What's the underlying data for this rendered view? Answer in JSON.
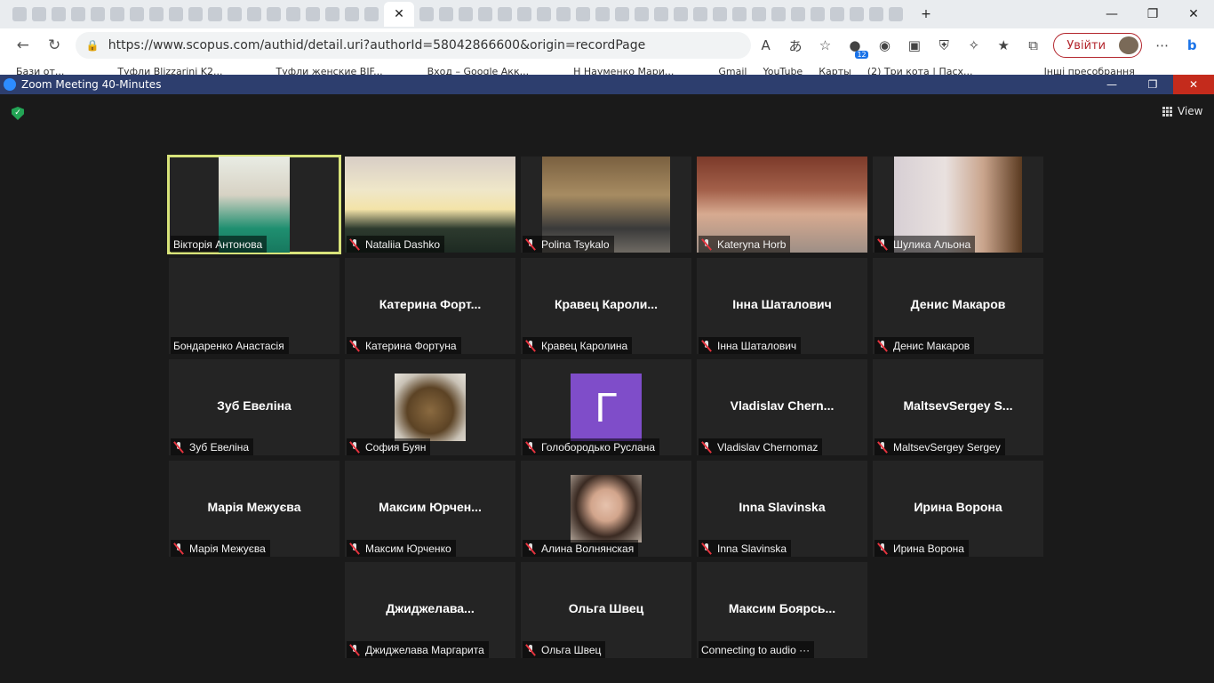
{
  "browser": {
    "url": "https://www.scopus.com/authid/detail.uri?authorId=58042866600&origin=recordPage",
    "login_label": "Увійти",
    "badge_count": "12",
    "bookmarks": [
      "Бази от...",
      "Туфли Blizzarini K2...",
      "Туфли женские BIF...",
      "Вход – Google Акк...",
      "Н Науменко Мари...",
      "Gmail",
      "YouTube",
      "Карты",
      "(2) Три кота | Пасх...",
      "Інші пресобрання"
    ]
  },
  "zoom": {
    "window_title": "Zoom Meeting 40-Minutes",
    "view_label": "View",
    "accent_active": "#d8e37a",
    "participants": [
      {
        "name": "Вікторія Антонова",
        "display": "",
        "video": "photo",
        "muted": false,
        "active": true,
        "row": 0,
        "col": 0
      },
      {
        "name": "Nataliia Dashko",
        "display": "",
        "video": "photo",
        "muted": true,
        "row": 0,
        "col": 1
      },
      {
        "name": "Polina Tsykalo",
        "display": "",
        "video": "photo",
        "muted": true,
        "row": 0,
        "col": 2
      },
      {
        "name": "Kateryna Horb",
        "display": "",
        "video": "photo",
        "muted": true,
        "row": 0,
        "col": 3
      },
      {
        "name": "Шулика Альона",
        "display": "",
        "video": "photo",
        "muted": true,
        "row": 0,
        "col": 4
      },
      {
        "name": "Бондаренко Анастасія",
        "display": "",
        "video": "none",
        "muted": false,
        "row": 1,
        "col": 0
      },
      {
        "name": "Катерина Фортуна",
        "display": "Катерина  Форт...",
        "video": "none",
        "muted": true,
        "row": 1,
        "col": 1
      },
      {
        "name": "Кравец Каролина",
        "display": "Кравец  Кароли...",
        "video": "none",
        "muted": true,
        "row": 1,
        "col": 2
      },
      {
        "name": "Інна Шаталович",
        "display": "Інна Шаталович",
        "video": "none",
        "muted": true,
        "row": 1,
        "col": 3
      },
      {
        "name": "Денис Макаров",
        "display": "Денис Макаров",
        "video": "none",
        "muted": true,
        "row": 1,
        "col": 4
      },
      {
        "name": "Зуб Евеліна",
        "display": "Зуб Евеліна",
        "video": "none",
        "muted": true,
        "row": 2,
        "col": 0
      },
      {
        "name": "София Буян",
        "display": "",
        "video": "avatar-cat",
        "muted": true,
        "row": 2,
        "col": 1
      },
      {
        "name": "Голобородько Руслана",
        "display": "",
        "video": "letter",
        "letter": "Г",
        "muted": true,
        "row": 2,
        "col": 2
      },
      {
        "name": "Vladislav Chernomaz",
        "display": "Vladislav  Chern...",
        "video": "none",
        "muted": true,
        "row": 2,
        "col": 3
      },
      {
        "name": "MaltsevSergey Sergey",
        "display": "MaltsevSergey  S...",
        "video": "none",
        "muted": true,
        "row": 2,
        "col": 4
      },
      {
        "name": "Марія Межуєва",
        "display": "Марія Межуєва",
        "video": "none",
        "muted": true,
        "row": 3,
        "col": 0
      },
      {
        "name": "Максим Юрченко",
        "display": "Максим  Юрчен...",
        "video": "none",
        "muted": true,
        "row": 3,
        "col": 1
      },
      {
        "name": "Алина Волнянская",
        "display": "",
        "video": "avatar-photo",
        "muted": true,
        "row": 3,
        "col": 2
      },
      {
        "name": "Inna Slavinska",
        "display": "Inna Slavinska",
        "video": "none",
        "muted": true,
        "row": 3,
        "col": 3
      },
      {
        "name": "Ирина Ворона",
        "display": "Ирина Ворона",
        "video": "none",
        "muted": true,
        "row": 3,
        "col": 4
      },
      {
        "name": "Джиджелава Маргарита",
        "display": "Джиджелава...",
        "video": "none",
        "muted": true,
        "row": 4,
        "col": 1
      },
      {
        "name": "Ольга Швец",
        "display": "Ольга Швец",
        "video": "none",
        "muted": true,
        "row": 4,
        "col": 2
      },
      {
        "name": "Connecting to audio ···",
        "display": "Максим  Боярсь...",
        "video": "none",
        "muted": false,
        "row": 4,
        "col": 3
      }
    ]
  }
}
